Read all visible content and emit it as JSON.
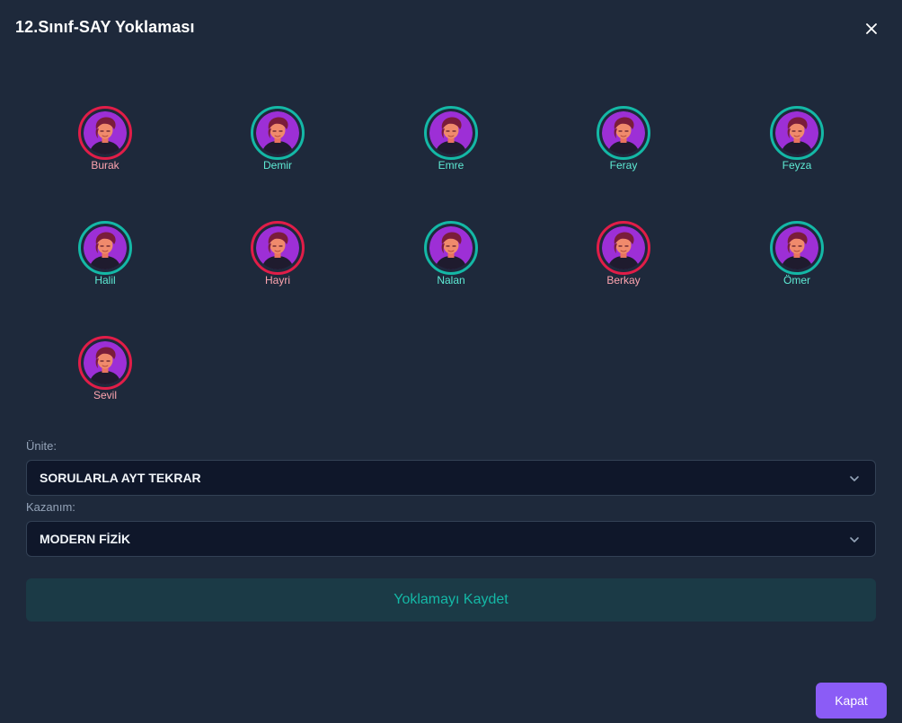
{
  "modal": {
    "title": "12.Sınıf-SAY Yoklaması"
  },
  "colors": {
    "present": "#14b8a6",
    "absent": "#e11d48",
    "present_text": "#5eead4",
    "absent_text": "#fda4af"
  },
  "students": [
    {
      "name": "Burak",
      "status": "absent"
    },
    {
      "name": "Demir",
      "status": "present"
    },
    {
      "name": "Emre",
      "status": "present"
    },
    {
      "name": "Feray",
      "status": "present"
    },
    {
      "name": "Feyza",
      "status": "present"
    },
    {
      "name": "Halil",
      "status": "present"
    },
    {
      "name": "Hayri",
      "status": "absent"
    },
    {
      "name": "Nalan",
      "status": "present"
    },
    {
      "name": "Berkay",
      "status": "absent"
    },
    {
      "name": "Ömer",
      "status": "present"
    },
    {
      "name": "Sevil",
      "status": "absent"
    }
  ],
  "form": {
    "unit_label": "Ünite:",
    "unit_value": "SORULARLA AYT TEKRAR",
    "outcome_label": "Kazanım:",
    "outcome_value": "MODERN FİZİK"
  },
  "buttons": {
    "save": "Yoklamayı Kaydet",
    "close": "Kapat"
  },
  "icons": {
    "close": "close-icon",
    "chevron": "chevron-down-icon",
    "avatar": "avatar-illustration"
  }
}
